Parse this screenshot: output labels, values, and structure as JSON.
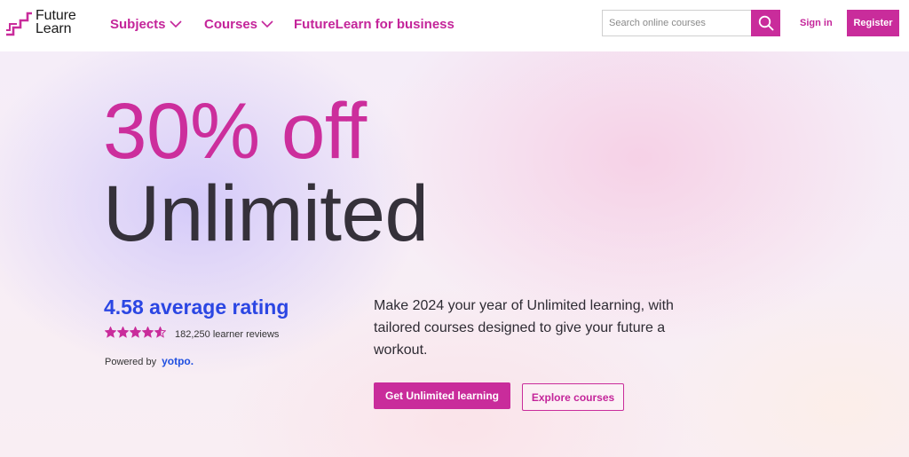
{
  "header": {
    "logo_line1": "Future",
    "logo_line2": "Learn",
    "nav": [
      {
        "label": "Subjects"
      },
      {
        "label": "Courses"
      },
      {
        "label": "FutureLearn for business"
      }
    ],
    "search_placeholder": "Search online courses",
    "signin_label": "Sign in",
    "register_label": "Register"
  },
  "hero": {
    "headline_1": "30% off",
    "headline_2": "Unlimited",
    "rating_text": "4.58 average rating",
    "rating_value": 4.58,
    "rating_max": 5,
    "reviews_text": "182,250 learner reviews",
    "powered_by": "Powered by",
    "powered_brand": "yotpo.",
    "description": "Make 2024 your year of Unlimited learning, with tailored courses designed to give your future a workout.",
    "cta_primary": "Get Unlimited learning",
    "cta_secondary": "Explore courses"
  },
  "colors": {
    "brand": "#c92c9b",
    "rating_blue": "#2b46e3",
    "heading_dark": "#35313a"
  }
}
